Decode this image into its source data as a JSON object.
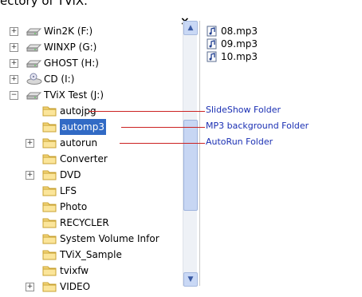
{
  "caption": "ectory of TViX.",
  "window": {
    "close_label": "×"
  },
  "tree": [
    {
      "label": "Win2K (F:)",
      "icon": "drive-icon",
      "expander": "+"
    },
    {
      "label": "WINXP (G:)",
      "icon": "drive-icon",
      "expander": "+"
    },
    {
      "label": "GHOST (H:)",
      "icon": "drive-icon",
      "expander": "+"
    },
    {
      "label": "CD (I:)",
      "icon": "cd-drive-icon",
      "expander": "+"
    },
    {
      "label": "TViX Test (J:)",
      "icon": "drive-icon",
      "expander": "−"
    },
    {
      "label": "autojpg",
      "icon": "folder-icon",
      "expander": ""
    },
    {
      "label": "automp3",
      "icon": "folder-icon",
      "expander": "",
      "selected": true
    },
    {
      "label": "autorun",
      "icon": "folder-icon",
      "expander": "+"
    },
    {
      "label": "Converter",
      "icon": "folder-icon",
      "expander": ""
    },
    {
      "label": "DVD",
      "icon": "folder-icon",
      "expander": "+"
    },
    {
      "label": "LFS",
      "icon": "folder-icon",
      "expander": ""
    },
    {
      "label": "Photo",
      "icon": "folder-icon",
      "expander": ""
    },
    {
      "label": "RECYCLER",
      "icon": "folder-icon",
      "expander": ""
    },
    {
      "label": "System Volume Infor",
      "icon": "folder-icon",
      "expander": ""
    },
    {
      "label": "TViX_Sample",
      "icon": "folder-icon",
      "expander": ""
    },
    {
      "label": "tvixfw",
      "icon": "folder-icon",
      "expander": ""
    },
    {
      "label": "VIDEO",
      "icon": "folder-icon",
      "expander": "+"
    }
  ],
  "files": [
    "08.mp3",
    "09.mp3",
    "10.mp3"
  ],
  "annotations": [
    {
      "text": "SlideShow Folder"
    },
    {
      "text": "MP3 background Folder"
    },
    {
      "text": "AutoRun Folder"
    }
  ],
  "scrollbar": {
    "up": "▲",
    "down": "▼"
  },
  "colors": {
    "selection": "#316ac5",
    "annotation_line": "#cc2222",
    "annotation_text": "#1a2fb3"
  }
}
